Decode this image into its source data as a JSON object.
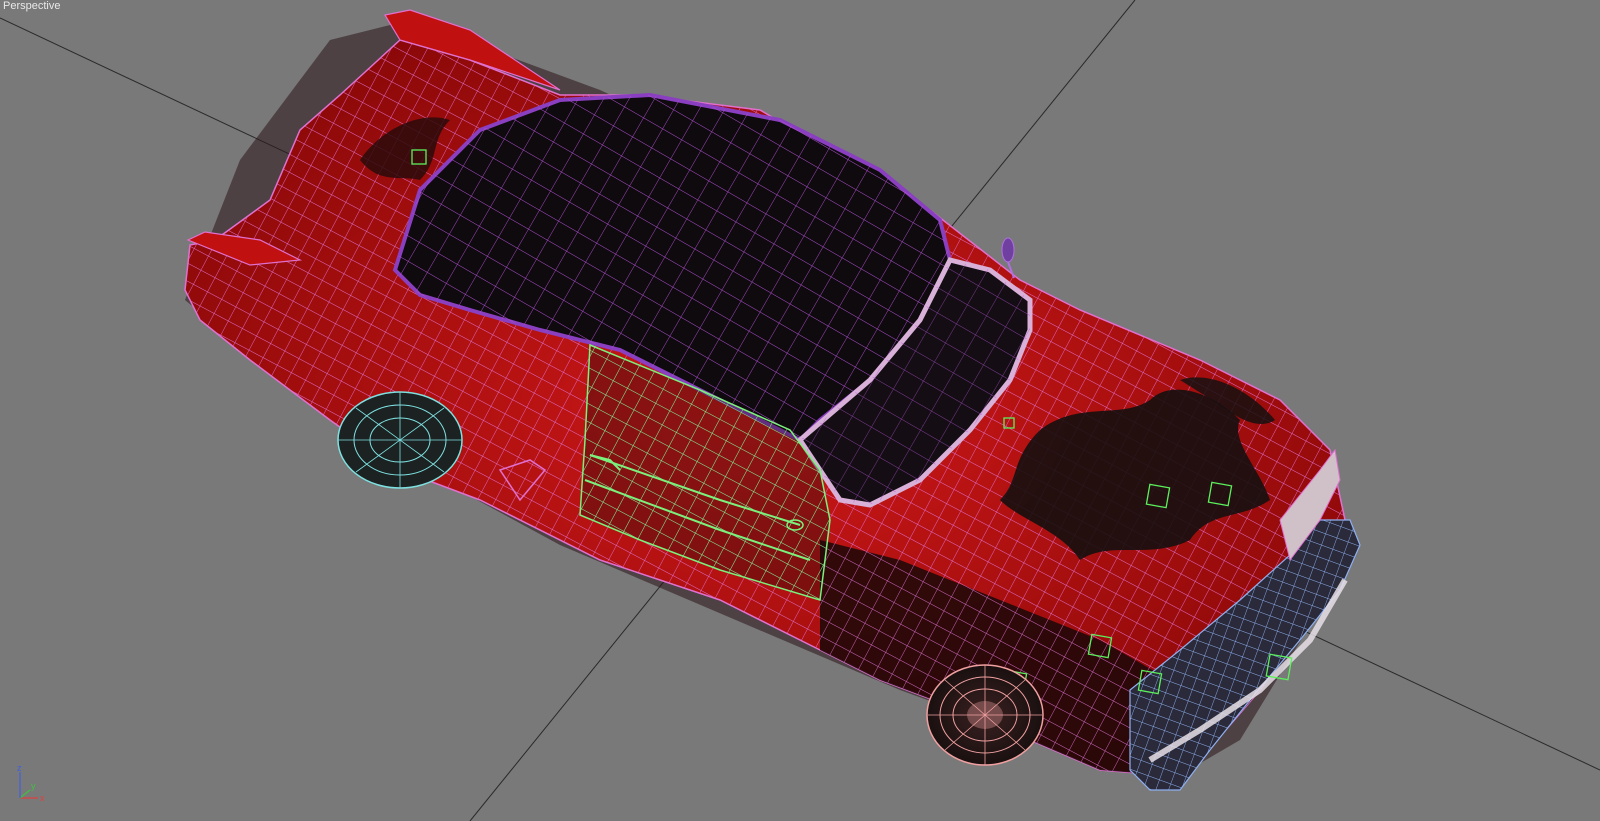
{
  "viewport": {
    "label": "Perspective",
    "background_color": "#797979"
  },
  "gizmo": {
    "x_label": "x",
    "y_label": "y",
    "z_label": "z",
    "x_color": "#e04040",
    "y_color": "#40c040",
    "z_color": "#4060e0"
  },
  "model": {
    "body_color": "#b50f0f",
    "roof_color": "#111111",
    "wire_color": "#e070d0",
    "door_wire_color": "#7cf07c",
    "front_wheel_wire_color": "#f0a0a0",
    "rear_wheel_wire_color": "#7fe0e0",
    "bumper_wire_color": "#8fb0f0"
  }
}
